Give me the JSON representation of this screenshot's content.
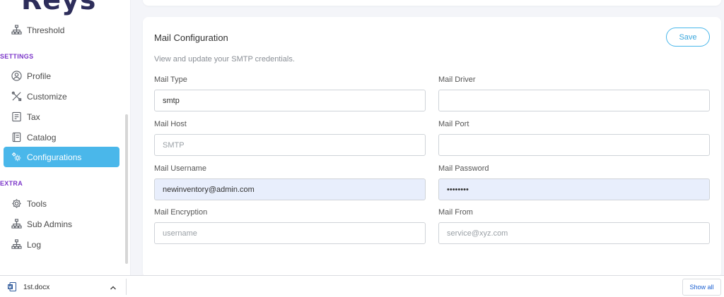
{
  "logo": {
    "text": "Reys"
  },
  "sidebar": {
    "threshold": {
      "label": "Threshold",
      "icon": "sitemap-icon"
    },
    "settings_label": "SETTINGS",
    "settings_items": [
      {
        "label": "Profile",
        "icon": "user-circle-icon"
      },
      {
        "label": "Customize",
        "icon": "tools-cross-icon"
      },
      {
        "label": "Tax",
        "icon": "receipt-icon"
      },
      {
        "label": "Catalog",
        "icon": "book-icon"
      },
      {
        "label": "Configurations",
        "icon": "cogs-icon",
        "active": true
      }
    ],
    "extra_label": "EXTRA",
    "extra_items": [
      {
        "label": "Tools",
        "icon": "gear-icon"
      },
      {
        "label": "Sub Admins",
        "icon": "sitemap-icon"
      },
      {
        "label": "Log",
        "icon": "sitemap-icon"
      }
    ]
  },
  "card": {
    "title": "Mail Configuration",
    "subtitle": "View and update your SMTP credentials.",
    "save_label": "Save",
    "fields": {
      "mail_type": {
        "label": "Mail Type",
        "value": "smtp",
        "placeholder": ""
      },
      "mail_driver": {
        "label": "Mail Driver",
        "value": "",
        "placeholder": ""
      },
      "mail_host": {
        "label": "Mail Host",
        "value": "",
        "placeholder": "SMTP"
      },
      "mail_port": {
        "label": "Mail Port",
        "value": "",
        "placeholder": ""
      },
      "mail_username": {
        "label": "Mail Username",
        "value": "newinventory@admin.com",
        "placeholder": ""
      },
      "mail_password": {
        "label": "Mail Password",
        "value": "password",
        "placeholder": ""
      },
      "mail_encryption": {
        "label": "Mail Encryption",
        "value": "",
        "placeholder": "username"
      },
      "mail_from": {
        "label": "Mail From",
        "value": "",
        "placeholder": "service@xyz.com"
      }
    }
  },
  "downloads": {
    "file_name": "1st.docx",
    "file_icon": "word-doc-icon",
    "show_all_label": "Show all"
  },
  "colors": {
    "accent": "#4ab7ea",
    "section_label": "#7b35c9",
    "autofill": "#e8eefc"
  }
}
